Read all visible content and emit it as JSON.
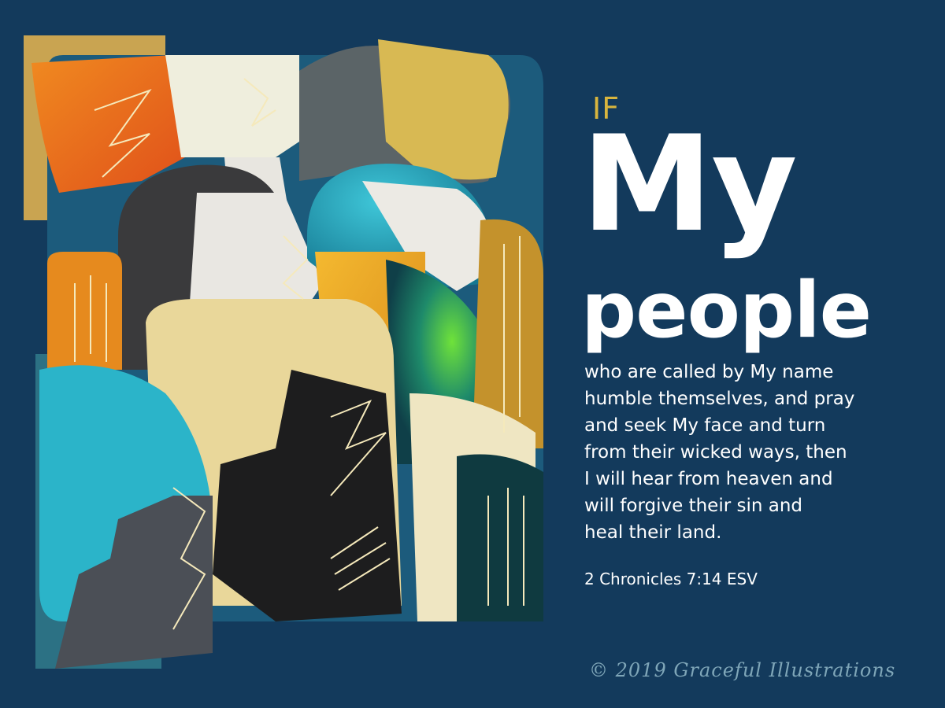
{
  "title": {
    "if": "IF",
    "my": "My",
    "people": "people"
  },
  "verse": {
    "lines": [
      "who are called by My name",
      "humble themselves, and pray",
      "and seek My face and turn",
      "from their wicked ways, then",
      "I will hear from heaven and",
      "will forgive their sin and",
      "heal their land."
    ],
    "reference": "2 Chronicles 7:14 ESV"
  },
  "footer": {
    "copyright": "© 2019 Graceful Illustrations"
  },
  "colors": {
    "background": "#133a5c",
    "accent_gold": "#d8b53e",
    "text": "#ffffff",
    "footer": "#7fa6b8"
  },
  "illustration": {
    "subject": "abstract group of stylized faces"
  }
}
